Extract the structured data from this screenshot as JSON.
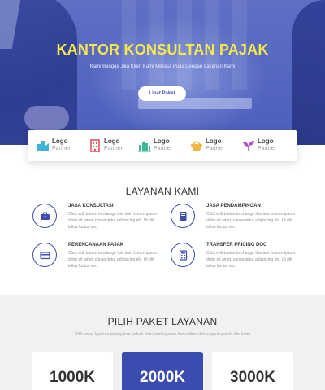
{
  "hero": {
    "title": "KANTOR KONSULTAN PAJAK",
    "subtitle": "Kami Bangga Jika Klien Kami Merasa Puas Dengan Layanan Kami",
    "button_label": "Lihat Paket"
  },
  "partners": [
    {
      "title": "Logo",
      "sub": "Partner",
      "icon": "building-blocks-icon",
      "color": "#3fb3d8"
    },
    {
      "title": "Logo",
      "sub": "Partner",
      "icon": "tower-building-icon",
      "color": "#e2555f"
    },
    {
      "title": "Logo",
      "sub": "Partner",
      "icon": "city-skyline-icon",
      "color": "#3fb89a"
    },
    {
      "title": "Logo",
      "sub": "Partner",
      "icon": "basket-icon",
      "color": "#f2b843"
    },
    {
      "title": "Logo",
      "sub": "Partner",
      "icon": "sprout-icon",
      "color": "#b04fcf"
    }
  ],
  "services": {
    "title": "LAYANAN KAMI",
    "items": [
      {
        "title": "JASA KONSULTASI",
        "desc": "Click edit button to change this text. Lorem ipsum dolor sit amet, consectetur adipiscing elit. Ut elit tellus luctus nec",
        "icon": "briefcase-icon"
      },
      {
        "title": "JASA PENDAMPINGAN",
        "desc": "Click edit button to change this text. Lorem ipsum dolor sit amet, consectetur adipiscing elit. Ut elit tellus luctus nec",
        "icon": "book-icon"
      },
      {
        "title": "PERENCANAAN PAJAK",
        "desc": "Click edit button to change this text. Lorem ipsum dolor sit amet, consectetur adipiscing elit. Ut elit tellus luctus nec",
        "icon": "credit-card-icon"
      },
      {
        "title": "TRANSFER PRICING DOC",
        "desc": "Click edit button to change this text. Lorem ipsum dolor sit amet, consectetur adipiscing elit. Ut elit tellus luctus nec",
        "icon": "calculator-icon"
      }
    ]
  },
  "pricing": {
    "title": "PILIH PAKET LAYANAN",
    "subtitle": "Pilih paket layanan perpajakan terbaik dan kami layanan berkualitas dan support penuh dari kami",
    "plans": [
      {
        "amount": "1000K",
        "featured": false
      },
      {
        "amount": "2000K",
        "featured": true
      },
      {
        "amount": "3000K",
        "featured": false
      }
    ]
  },
  "colors": {
    "accent": "#3b4cb0",
    "hero_title": "#f5e94a"
  }
}
